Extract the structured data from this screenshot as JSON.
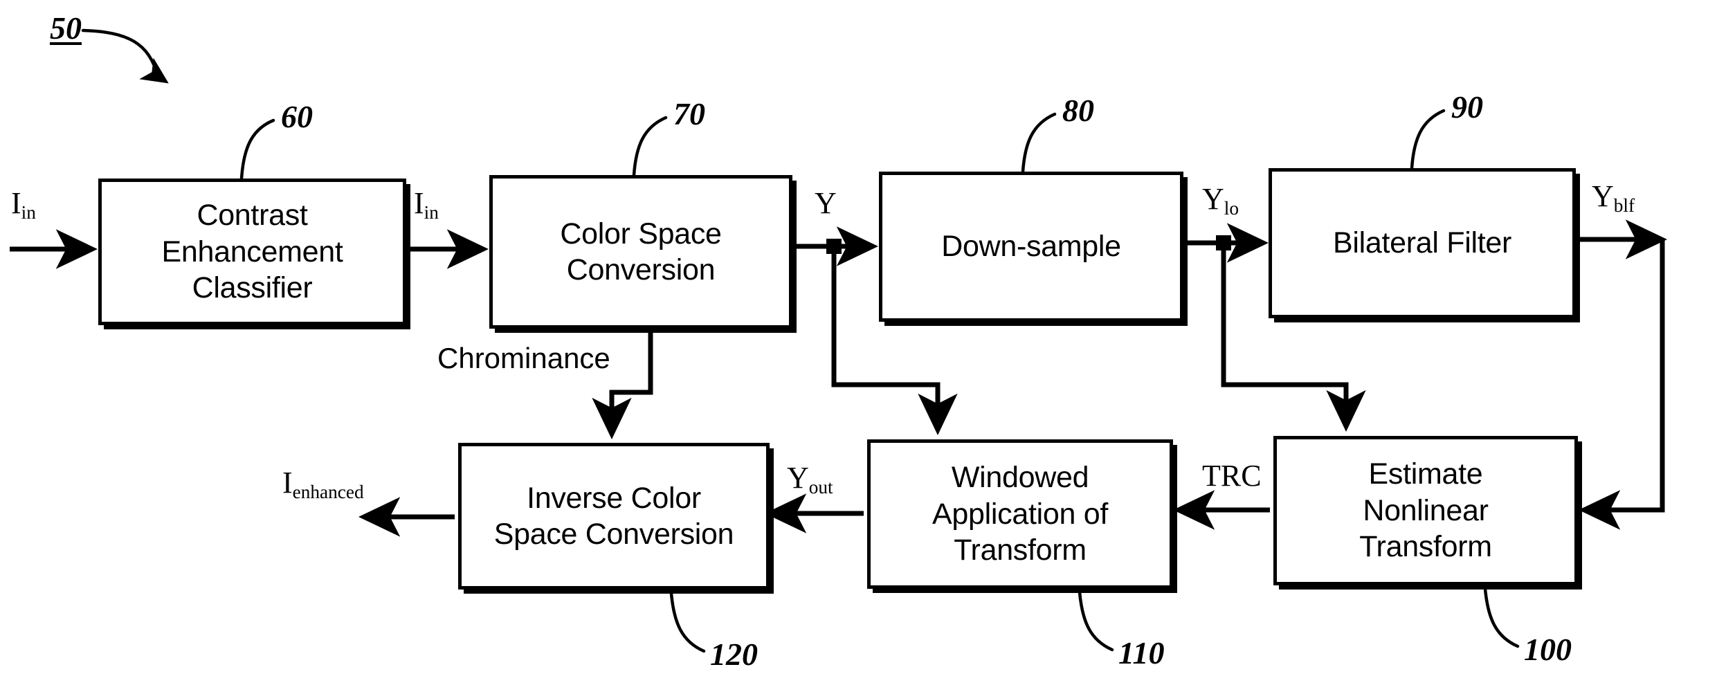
{
  "figure": {
    "id_label": "50",
    "title": "Contrast enhancement processing pipeline block diagram"
  },
  "blocks": [
    {
      "ref": "60",
      "label": "Contrast\nEnhancement\nClassifier"
    },
    {
      "ref": "70",
      "label": "Color Space\nConversion"
    },
    {
      "ref": "80",
      "label": "Down-sample"
    },
    {
      "ref": "90",
      "label": "Bilateral Filter"
    },
    {
      "ref": "100",
      "label": "Estimate\nNonlinear\nTransform"
    },
    {
      "ref": "110",
      "label": "Windowed\nApplication of\nTransform"
    },
    {
      "ref": "120",
      "label": "Inverse Color\nSpace Conversion"
    }
  ],
  "block_text": {
    "contrast_enhancement_classifier_line1": "Contrast",
    "contrast_enhancement_classifier_line2": "Enhancement",
    "contrast_enhancement_classifier_line3": "Classifier",
    "color_space_conversion_line1": "Color Space",
    "color_space_conversion_line2": "Conversion",
    "down_sample": "Down-sample",
    "bilateral_filter": "Bilateral Filter",
    "estimate_nonlinear_transform_line1": "Estimate",
    "estimate_nonlinear_transform_line2": "Nonlinear",
    "estimate_nonlinear_transform_line3": "Transform",
    "windowed_application_line1": "Windowed",
    "windowed_application_line2": "Application of",
    "windowed_application_line3": "Transform",
    "inverse_color_space_line1": "Inverse Color",
    "inverse_color_space_line2": "Space Conversion"
  },
  "signals": [
    {
      "name": "input-image",
      "base": "I",
      "sub": "in"
    },
    {
      "name": "classified-image",
      "base": "I",
      "sub": "in"
    },
    {
      "name": "luminance",
      "base": "Y",
      "sub": ""
    },
    {
      "name": "low-res-luminance",
      "base": "Y",
      "sub": "lo"
    },
    {
      "name": "bilateral-filtered",
      "base": "Y",
      "sub": "blf"
    },
    {
      "name": "chrominance",
      "base": "Chrominance",
      "sub": ""
    },
    {
      "name": "tone-repro-curve",
      "base": "TRC",
      "sub": ""
    },
    {
      "name": "output-luminance",
      "base": "Y",
      "sub": "out"
    },
    {
      "name": "enhanced-image",
      "base": "I",
      "sub": "enhanced"
    }
  ],
  "signal_text": {
    "i_in_base": "I",
    "i_in_sub": "in",
    "y_base": "Y",
    "y_lo_base": "Y",
    "y_lo_sub": "lo",
    "y_blf_base": "Y",
    "y_blf_sub": "blf",
    "chrominance": "Chrominance",
    "trc": "TRC",
    "y_out_base": "Y",
    "y_out_sub": "out",
    "i_enhanced_base": "I",
    "i_enhanced_sub": "enhanced"
  },
  "ref_numerals": {
    "figure": "50",
    "b60": "60",
    "b70": "70",
    "b80": "80",
    "b90": "90",
    "b100": "100",
    "b110": "110",
    "b120": "120"
  },
  "colors": {
    "stroke": "#000000",
    "background": "#ffffff"
  }
}
